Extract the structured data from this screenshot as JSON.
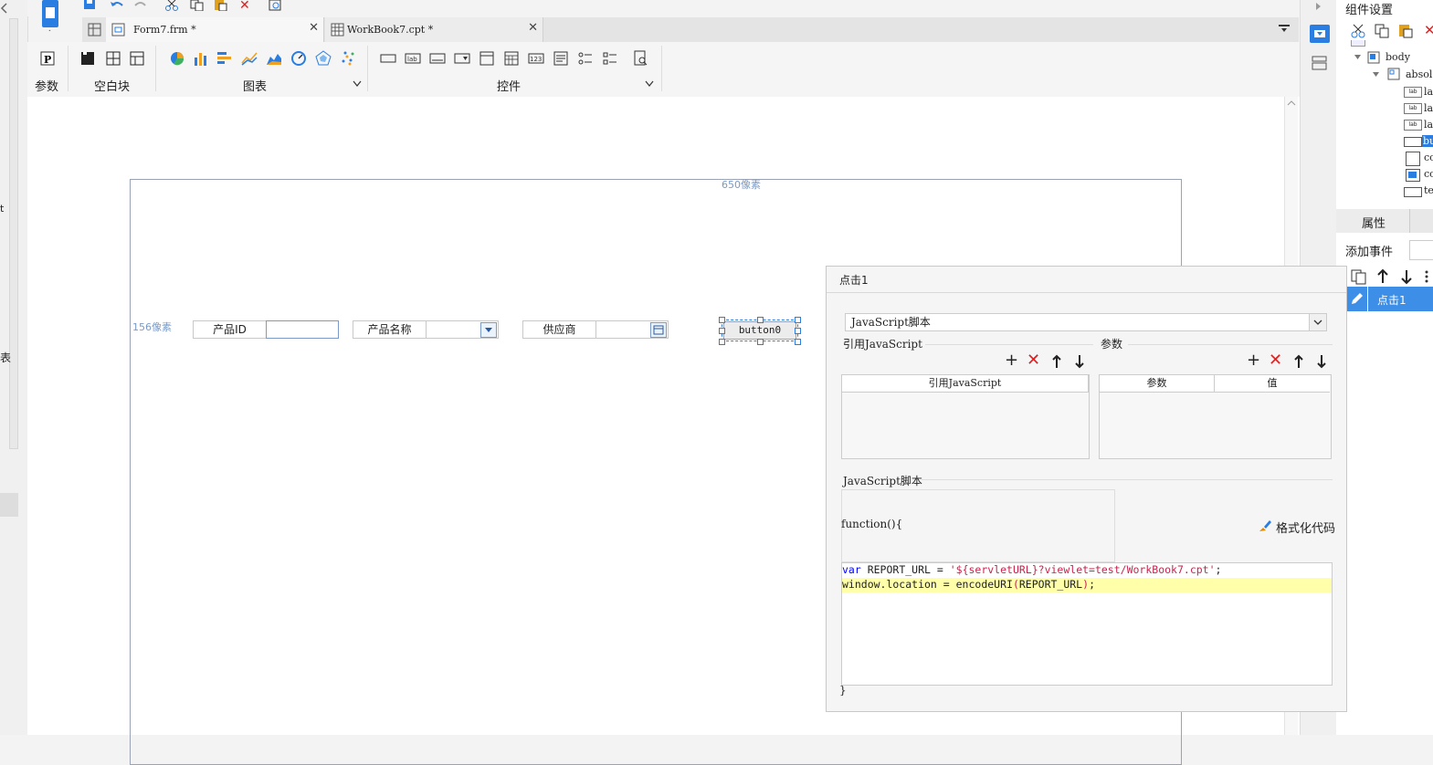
{
  "tabs": [
    {
      "label": "Form7.frm *"
    },
    {
      "label": "WorkBook7.cpt *"
    }
  ],
  "ribbon": {
    "groups": [
      {
        "label": "参数"
      },
      {
        "label": "空白块"
      },
      {
        "label": "图表"
      },
      {
        "label": "控件"
      }
    ]
  },
  "canvas": {
    "width_label": "650像素",
    "height_label": "156像素",
    "widgets": {
      "product_id_label": "产品ID",
      "product_name_label": "产品名称",
      "supplier_label": "供应商",
      "button_label": "button0"
    }
  },
  "left_strip": {
    "frag1": "t",
    "frag2": "表"
  },
  "right_panel": {
    "title": "组件设置",
    "tree": {
      "body": "body",
      "absolute": "absol",
      "items": [
        "la",
        "la",
        "la",
        "bu",
        "co",
        "co",
        "te"
      ]
    },
    "tab_attr": "属性",
    "add_event_label": "添加事件",
    "event_item": "点击1"
  },
  "dialog": {
    "title": "点击1",
    "type_select": "JavaScript脚本",
    "ref_js_title": "引用JavaScript",
    "params_title": "参数",
    "ref_js_header": "引用JavaScript",
    "param_header": "参数",
    "value_header": "值",
    "script_title": "JavaScript脚本",
    "function_open": "function(){",
    "format_code": "格式化代码",
    "code": {
      "line1_kw": "var",
      "line1_mid": " REPORT_URL = ",
      "line1_str": "'${servletURL}?viewlet=test/WorkBook7.cpt'",
      "line1_end": ";",
      "line2_a": "window.location = encodeURI",
      "line2_paren_open": "(",
      "line2_b": "REPORT_URL",
      "line2_paren_close": ")",
      "line2_end": ";"
    },
    "function_close": "}"
  },
  "colors": {
    "accent": "#2a7de1",
    "selection": "#3c8ee6",
    "highlight_line": "#ffffaa",
    "keyword": "#0000ff",
    "string": "#c7254e",
    "delete": "#e02020"
  }
}
